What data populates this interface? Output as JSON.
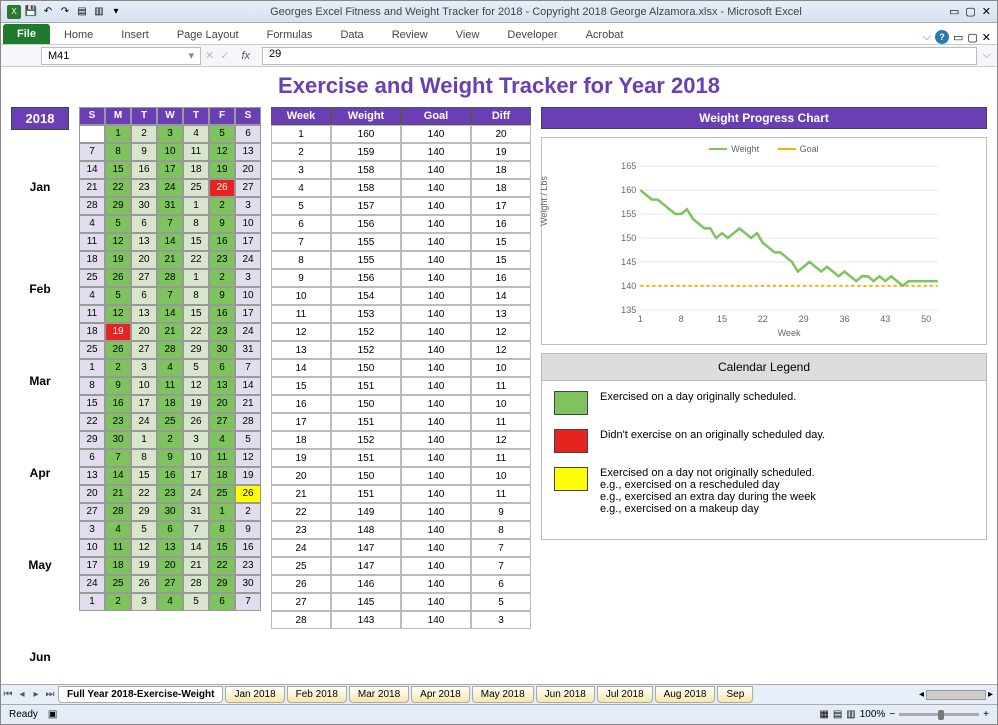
{
  "window_title": "Georges Excel Fitness and Weight Tracker for 2018 - Copyright 2018 George Alzamora.xlsx  -  Microsoft Excel",
  "ribbon_tabs": [
    "File",
    "Home",
    "Insert",
    "Page Layout",
    "Formulas",
    "Data",
    "Review",
    "View",
    "Developer",
    "Acrobat"
  ],
  "name_box": "M41",
  "formula_value": "29",
  "headline": "Exercise and Weight Tracker for Year 2018",
  "year": "2018",
  "days": [
    "S",
    "M",
    "T",
    "W",
    "T",
    "F",
    "S"
  ],
  "months": [
    "Jan",
    "Feb",
    "Mar",
    "Apr",
    "May",
    "Jun"
  ],
  "calendar_rows": [
    [
      "",
      "1:g",
      "2:lg",
      "3:g",
      "4:lg",
      "5:g",
      "6:lav"
    ],
    [
      "7:lav",
      "8:g",
      "9:lg",
      "10:g",
      "11:lg",
      "12:g",
      "13:lav"
    ],
    [
      "14:lav",
      "15:g",
      "16:lg",
      "17:g",
      "18:lg",
      "19:g",
      "20:lav"
    ],
    [
      "21:lav",
      "22:g",
      "23:lg",
      "24:g",
      "25:lg",
      "26:red",
      "27:lav"
    ],
    [
      "28:lav",
      "29:g",
      "30:lg",
      "31:g",
      "1:lg",
      "2:g",
      "3:lav"
    ],
    [
      "4:lav",
      "5:g",
      "6:lg",
      "7:g",
      "8:lg",
      "9:g",
      "10:lav"
    ],
    [
      "11:lav",
      "12:g",
      "13:lg",
      "14:g",
      "15:lg",
      "16:g",
      "17:lav"
    ],
    [
      "18:lav",
      "19:g",
      "20:lg",
      "21:g",
      "22:lg",
      "23:g",
      "24:lav"
    ],
    [
      "25:lav",
      "26:g",
      "27:lg",
      "28:g",
      "1:lg",
      "2:g",
      "3:lav"
    ],
    [
      "4:lav",
      "5:g",
      "6:lg",
      "7:g",
      "8:lg",
      "9:g",
      "10:lav"
    ],
    [
      "11:lav",
      "12:g",
      "13:lg",
      "14:g",
      "15:lg",
      "16:g",
      "17:lav"
    ],
    [
      "18:lav",
      "19:red",
      "20:lg",
      "21:g",
      "22:lg",
      "23:g",
      "24:lav"
    ],
    [
      "25:lav",
      "26:g",
      "27:lg",
      "28:g",
      "29:lg",
      "30:g",
      "31:lav"
    ],
    [
      "1:lav",
      "2:g",
      "3:lg",
      "4:g",
      "5:lg",
      "6:g",
      "7:lav"
    ],
    [
      "8:lav",
      "9:g",
      "10:lg",
      "11:g",
      "12:lg",
      "13:g",
      "14:lav"
    ],
    [
      "15:lav",
      "16:g",
      "17:lg",
      "18:g",
      "19:lg",
      "20:g",
      "21:lav"
    ],
    [
      "22:lav",
      "23:g",
      "24:lg",
      "25:g",
      "26:lg",
      "27:g",
      "28:lav"
    ],
    [
      "29:lav",
      "30:g",
      "1:lg",
      "2:g",
      "3:lg",
      "4:g",
      "5:lav"
    ],
    [
      "6:lav",
      "7:g",
      "8:lg",
      "9:g",
      "10:lg",
      "11:g",
      "12:lav"
    ],
    [
      "13:lav",
      "14:g",
      "15:lg",
      "16:g",
      "17:lg",
      "18:g",
      "19:lav"
    ],
    [
      "20:lav",
      "21:g",
      "22:lg",
      "23:g",
      "24:lg",
      "25:g",
      "26:yel"
    ],
    [
      "27:lav",
      "28:g",
      "29:lg",
      "30:g",
      "31:lg",
      "1:g",
      "2:lav"
    ],
    [
      "3:lav",
      "4:g",
      "5:lg",
      "6:g",
      "7:lg",
      "8:g",
      "9:lav"
    ],
    [
      "10:lav",
      "11:g",
      "12:lg",
      "13:g",
      "14:lg",
      "15:g",
      "16:lav"
    ],
    [
      "17:lav",
      "18:g",
      "19:lg",
      "20:g",
      "21:lg",
      "22:g",
      "23:lav"
    ],
    [
      "24:lav",
      "25:g",
      "26:lg",
      "27:g",
      "28:lg",
      "29:g",
      "30:lav"
    ],
    [
      "1:lav",
      "2:g",
      "3:lg",
      "4:g",
      "5:lg",
      "6:g",
      "7:lav"
    ]
  ],
  "wtable_headers": [
    "Week",
    "Weight",
    "Goal",
    "Diff"
  ],
  "wtable_rows": [
    [
      1,
      160,
      140,
      20
    ],
    [
      2,
      159,
      140,
      19
    ],
    [
      3,
      158,
      140,
      18
    ],
    [
      4,
      158,
      140,
      18
    ],
    [
      5,
      157,
      140,
      17
    ],
    [
      6,
      156,
      140,
      16
    ],
    [
      7,
      155,
      140,
      15
    ],
    [
      8,
      155,
      140,
      15
    ],
    [
      9,
      156,
      140,
      16
    ],
    [
      10,
      154,
      140,
      14
    ],
    [
      11,
      153,
      140,
      13
    ],
    [
      12,
      152,
      140,
      12
    ],
    [
      13,
      152,
      140,
      12
    ],
    [
      14,
      150,
      140,
      10
    ],
    [
      15,
      151,
      140,
      11
    ],
    [
      16,
      150,
      140,
      10
    ],
    [
      17,
      151,
      140,
      11
    ],
    [
      18,
      152,
      140,
      12
    ],
    [
      19,
      151,
      140,
      11
    ],
    [
      20,
      150,
      140,
      10
    ],
    [
      21,
      151,
      140,
      11
    ],
    [
      22,
      149,
      140,
      9
    ],
    [
      23,
      148,
      140,
      8
    ],
    [
      24,
      147,
      140,
      7
    ],
    [
      25,
      147,
      140,
      7
    ],
    [
      26,
      146,
      140,
      6
    ],
    [
      27,
      145,
      140,
      5
    ],
    [
      28,
      143,
      140,
      3
    ]
  ],
  "chart_title": "Weight Progress Chart",
  "chart_series": [
    "Weight",
    "Goal"
  ],
  "chart_ylabel": "Weight / Lbs",
  "chart_xlabel": "Week",
  "chart_yticks": [
    135,
    140,
    145,
    150,
    155,
    160,
    165
  ],
  "chart_xticks": [
    1,
    8,
    15,
    22,
    29,
    36,
    43,
    50
  ],
  "legend_title": "Calendar Legend",
  "legend_items": [
    {
      "color": "#7fc35f",
      "text": "Exercised on a day originally scheduled."
    },
    {
      "color": "#e5231f",
      "text": "Didn't exercise on an originally scheduled day."
    },
    {
      "color": "#ffff00",
      "text": "Exercised on a day not originally scheduled.\ne.g., exercised on a rescheduled day\ne.g., exercised an extra day during the week\ne.g., exercised on a makeup day"
    }
  ],
  "sheet_tabs": [
    "Full Year 2018-Exercise-Weight",
    "Jan 2018",
    "Feb 2018",
    "Mar 2018",
    "Apr 2018",
    "May 2018",
    "Jun 2018",
    "Jul 2018",
    "Aug 2018",
    "Sep"
  ],
  "status": "Ready",
  "zoom": "100%",
  "chart_data": {
    "type": "line",
    "title": "Weight Progress Chart",
    "xlabel": "Week",
    "ylabel": "Weight / Lbs",
    "ylim": [
      135,
      165
    ],
    "x": [
      1,
      2,
      3,
      4,
      5,
      6,
      7,
      8,
      9,
      10,
      11,
      12,
      13,
      14,
      15,
      16,
      17,
      18,
      19,
      20,
      21,
      22,
      23,
      24,
      25,
      26,
      27,
      28,
      29,
      30,
      31,
      32,
      33,
      34,
      35,
      36,
      37,
      38,
      39,
      40,
      41,
      42,
      43,
      44,
      45,
      46,
      47,
      48,
      49,
      50,
      51,
      52
    ],
    "series": [
      {
        "name": "Weight",
        "color": "#7fc35f",
        "values": [
          160,
          159,
          158,
          158,
          157,
          156,
          155,
          155,
          156,
          154,
          153,
          152,
          152,
          150,
          151,
          150,
          151,
          152,
          151,
          150,
          151,
          149,
          148,
          147,
          147,
          146,
          145,
          143,
          144,
          145,
          144,
          143,
          144,
          143,
          142,
          143,
          142,
          141,
          142,
          142,
          141,
          142,
          141,
          142,
          141,
          140,
          141,
          141,
          141,
          141,
          141,
          141
        ]
      },
      {
        "name": "Goal",
        "color": "#f5b400",
        "style": "dashed",
        "values": [
          140,
          140,
          140,
          140,
          140,
          140,
          140,
          140,
          140,
          140,
          140,
          140,
          140,
          140,
          140,
          140,
          140,
          140,
          140,
          140,
          140,
          140,
          140,
          140,
          140,
          140,
          140,
          140,
          140,
          140,
          140,
          140,
          140,
          140,
          140,
          140,
          140,
          140,
          140,
          140,
          140,
          140,
          140,
          140,
          140,
          140,
          140,
          140,
          140,
          140,
          140,
          140
        ]
      }
    ]
  }
}
